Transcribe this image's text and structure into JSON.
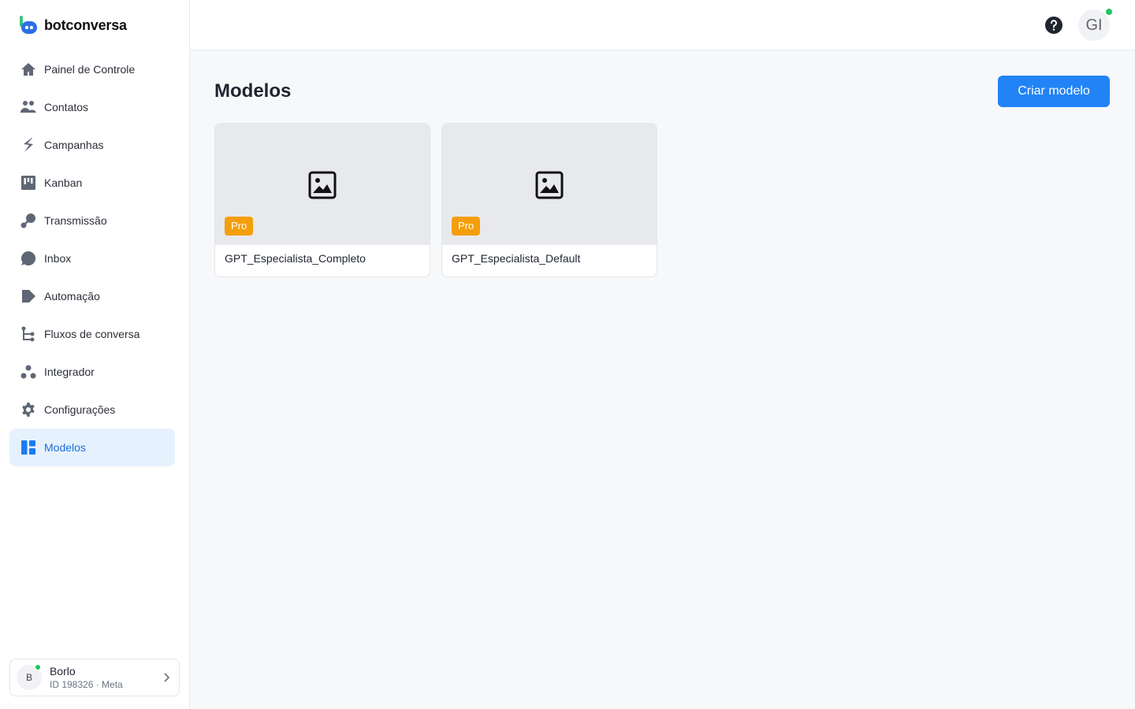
{
  "brand": {
    "name": "botconversa"
  },
  "sidebar": {
    "items": [
      {
        "label": "Painel de Controle",
        "icon": "home-icon"
      },
      {
        "label": "Contatos",
        "icon": "users-icon"
      },
      {
        "label": "Campanhas",
        "icon": "campaign-icon"
      },
      {
        "label": "Kanban",
        "icon": "kanban-icon"
      },
      {
        "label": "Transmissão",
        "icon": "broadcast-icon"
      },
      {
        "label": "Inbox",
        "icon": "chat-icon"
      },
      {
        "label": "Automação",
        "icon": "automation-icon"
      },
      {
        "label": "Fluxos de conversa",
        "icon": "flow-icon"
      },
      {
        "label": "Integrador",
        "icon": "integrator-icon"
      },
      {
        "label": "Configurações",
        "icon": "gear-icon"
      },
      {
        "label": "Modelos",
        "icon": "templates-icon",
        "active": true
      }
    ]
  },
  "account": {
    "initial": "B",
    "name": "Borlo",
    "subtitle": "ID 198326 · Meta"
  },
  "header": {
    "user_initials": "GI"
  },
  "main": {
    "title": "Modelos",
    "create_button": "Criar modelo",
    "cards": [
      {
        "badge": "Pro",
        "title": "GPT_Especialista_Completo"
      },
      {
        "badge": "Pro",
        "title": "GPT_Especialista_Default"
      }
    ]
  },
  "colors": {
    "accent": "#2283f6",
    "active_bg": "#e6f1fe",
    "pro_badge": "#f59e0b",
    "online": "#22c55e"
  }
}
